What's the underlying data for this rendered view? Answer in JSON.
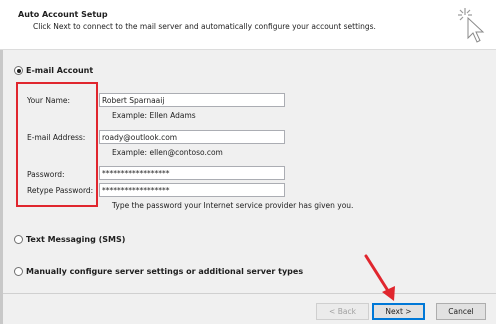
{
  "header": {
    "title": "Auto Account Setup",
    "subtitle": "Click Next to connect to the mail server and automatically configure your account settings.",
    "icon": "wizard-cursor-icon"
  },
  "email_account": {
    "option_label": "E-mail Account",
    "selected": true,
    "name_label": "Your Name:",
    "name_value": "Robert Sparnaaij",
    "name_example": "Example: Ellen Adams",
    "email_label": "E-mail Address:",
    "email_value": "roady@outlook.com",
    "email_example": "Example: ellen@contoso.com",
    "password_label": "Password:",
    "password_value": "******************",
    "retype_label": "Retype Password:",
    "retype_value": "******************",
    "password_hint": "Type the password your Internet service provider has given you."
  },
  "text_messaging": {
    "option_label": "Text Messaging (SMS)",
    "selected": false
  },
  "manual_config": {
    "option_label": "Manually configure server settings or additional server types",
    "selected": false
  },
  "footer": {
    "back_label": "< Back",
    "next_label": "Next >",
    "cancel_label": "Cancel"
  },
  "colors": {
    "highlight": "#e0262e",
    "arrow": "#e0262e",
    "focus": "#0078d7"
  }
}
